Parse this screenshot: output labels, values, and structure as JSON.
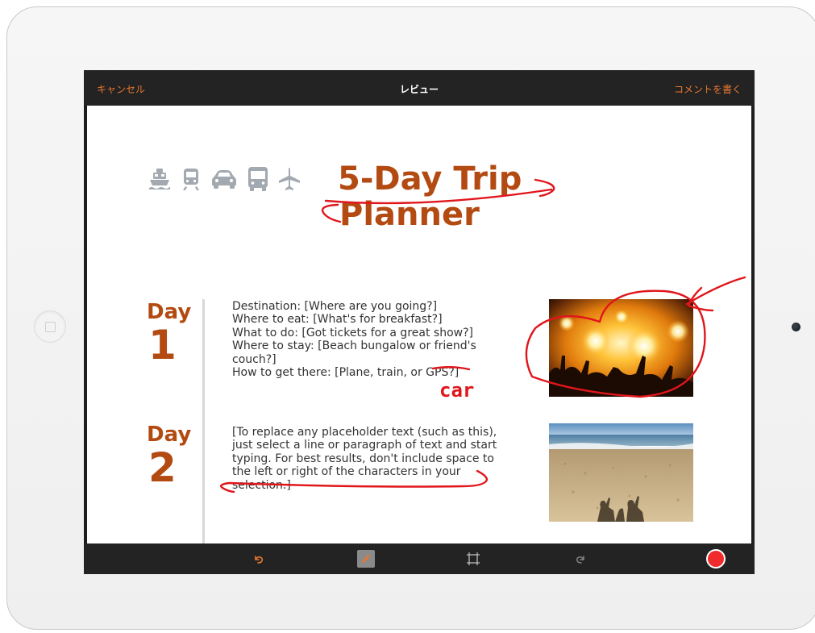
{
  "header": {
    "cancel_label": "キャンセル",
    "title": "レビュー",
    "write_comment_label": "コメントを書く"
  },
  "document": {
    "title_line1": "5-Day Trip",
    "title_line2": "Planner",
    "transport_icons": [
      "ship-icon",
      "train-icon",
      "car-icon",
      "bus-icon",
      "airplane-icon"
    ],
    "days": [
      {
        "label": "Day",
        "number": "1",
        "lines": [
          "Destination: [Where are you going?]",
          "Where to eat: [What's for breakfast?]",
          "What to do: [Got tickets for a great show?]",
          "Where to stay: [Beach bungalow or friend's",
          "couch?]",
          "How to get there: [Plane, train, or GPS?]"
        ],
        "photo": "concert-crowd-photo"
      },
      {
        "label": "Day",
        "number": "2",
        "lines": [
          "[To replace any placeholder text (such as this),",
          "just select a line or paragraph of text and start",
          "typing. For best results, don't include space to",
          "the left or right of the characters in your",
          "selection.]"
        ],
        "photo": "beach-shadows-photo"
      }
    ],
    "annotation_text": "car"
  },
  "toolbar": {
    "tools": [
      "undo-icon",
      "pen-icon",
      "crop-frame-icon",
      "redo-icon",
      "record-button"
    ]
  },
  "colors": {
    "accent": "#e7762f",
    "title": "#b34a12",
    "markup": "#e0161b",
    "icon_gray": "#a3a9b0",
    "bar": "#232323"
  }
}
